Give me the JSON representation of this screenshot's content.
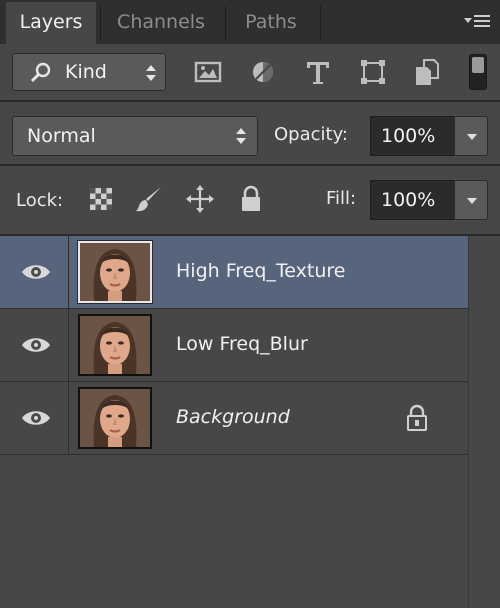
{
  "tabs": [
    {
      "label": "Layers",
      "active": true
    },
    {
      "label": "Channels",
      "active": false
    },
    {
      "label": "Paths",
      "active": false
    }
  ],
  "filter": {
    "kind_label": "Kind",
    "buttons": [
      "pixel-filter-icon",
      "adjustment-filter-icon",
      "type-filter-icon",
      "shape-filter-icon",
      "smart-object-filter-icon"
    ]
  },
  "blend": {
    "mode": "Normal",
    "opacity_label": "Opacity:",
    "opacity_value": "100%"
  },
  "lock": {
    "label": "Lock:",
    "fill_label": "Fill:",
    "fill_value": "100%",
    "buttons": [
      "lock-transparent-pixels-icon",
      "lock-image-pixels-icon",
      "lock-position-icon",
      "lock-all-icon"
    ]
  },
  "layers": [
    {
      "name": "High Freq_Texture",
      "selected": true,
      "visible": true,
      "locked": false
    },
    {
      "name": "Low Freq_Blur",
      "selected": false,
      "visible": true,
      "locked": false
    },
    {
      "name": "Background",
      "selected": false,
      "visible": true,
      "locked": true
    }
  ],
  "colors": {
    "panel_bg": "#474747",
    "selected_layer": "#56647c",
    "tabbar_bg": "#2f2f2f"
  }
}
